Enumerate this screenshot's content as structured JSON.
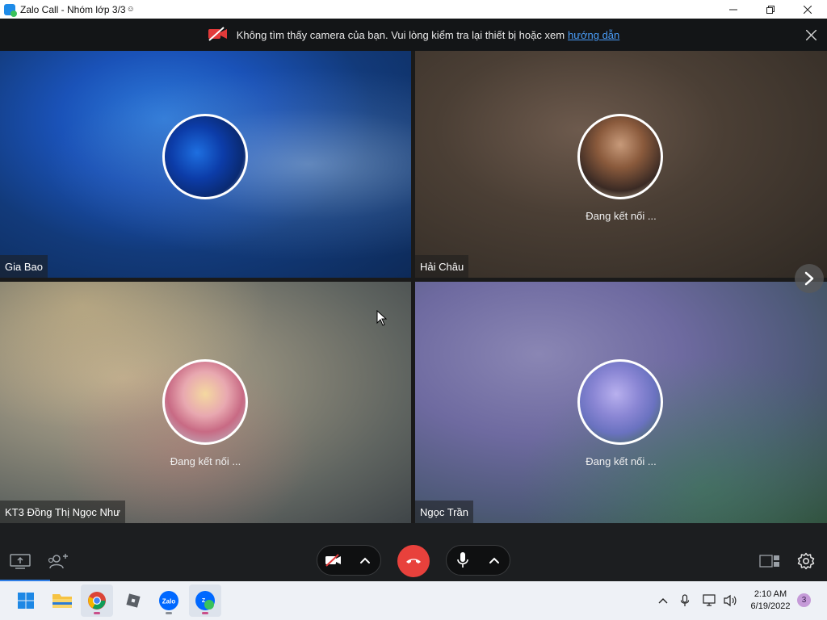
{
  "window": {
    "title": "Zalo Call - Nhóm lớp 3/3"
  },
  "notice": {
    "message": "Không tìm thấy camera của bạn. Vui lòng kiểm tra lại thiết bị hoặc xem",
    "link": "hướng dẫn"
  },
  "participants": [
    {
      "name": "Gia Bao",
      "status": ""
    },
    {
      "name": "Hải Châu",
      "status": "Đang kết nối ..."
    },
    {
      "name": "KT3 Đồng Thị Ngọc Như",
      "status": "Đang kết nối ..."
    },
    {
      "name": "Ngọc Trần",
      "status": "Đang kết nối ..."
    }
  ],
  "controls": {
    "left": [
      "screen-share-icon",
      "add-participant-icon"
    ],
    "center": [
      "camera-off-icon",
      "chevron-up-icon",
      "end-call-icon",
      "microphone-icon",
      "chevron-up-icon"
    ],
    "right": [
      "layout-icon",
      "settings-icon"
    ]
  },
  "taskbar": {
    "apps": [
      "windows-start-icon",
      "file-explorer-icon",
      "chrome-icon",
      "roblox-icon",
      "zalo-icon",
      "zalo-call-icon"
    ],
    "clock": {
      "time": "2:10 AM",
      "date": "6/19/2022"
    },
    "notification_count": "3"
  },
  "colors": {
    "end_call": "#e8413c",
    "link": "#4a9df8",
    "accent": "#2d7de6"
  }
}
